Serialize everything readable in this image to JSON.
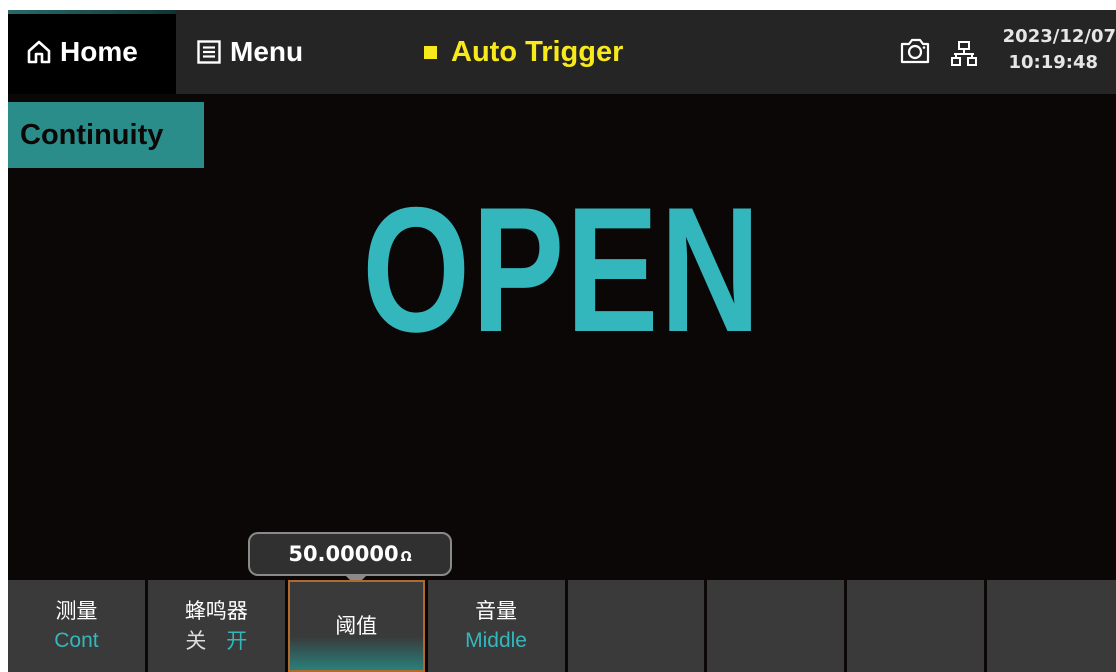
{
  "header": {
    "home_label": "Home",
    "menu_label": "Menu",
    "trigger_label": "Auto Trigger",
    "date": "2023/12/07",
    "time": "10:19:48",
    "icons": [
      "home-icon",
      "menu-icon",
      "camera-icon",
      "network-icon"
    ],
    "colors": {
      "trigger": "#f7e91c",
      "accent": "#33b7bc",
      "function_label_bg": "#2b8d8a"
    }
  },
  "main": {
    "function_label": "Continuity",
    "reading": "OPEN"
  },
  "threshold_popup": {
    "value": "50.00000",
    "unit": "Ω"
  },
  "softkeys": [
    {
      "label": "测量",
      "value": "Cont"
    },
    {
      "label": "蜂鸣器",
      "value_off": "关",
      "value_on": "开"
    },
    {
      "label": "阈值",
      "active": true
    },
    {
      "label": "音量",
      "value": "Middle"
    },
    {
      "label": ""
    },
    {
      "label": ""
    },
    {
      "label": ""
    },
    {
      "label": ""
    }
  ]
}
